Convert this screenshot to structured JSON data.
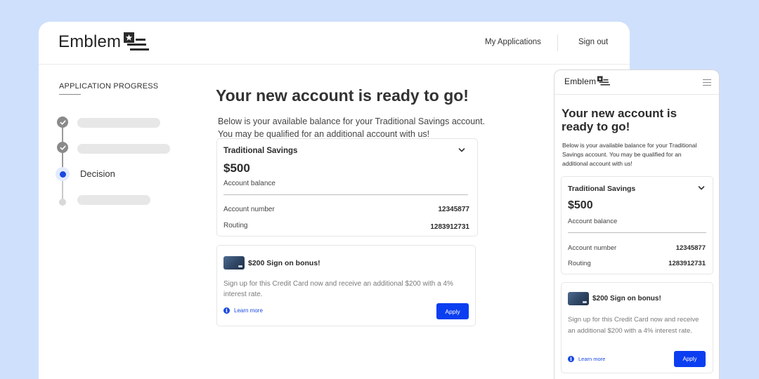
{
  "brand": {
    "name": "Emblem"
  },
  "nav": {
    "my_applications": "My Applications",
    "sign_out": "Sign out"
  },
  "progress": {
    "title": "APPLICATION PROGRESS",
    "steps": [
      {
        "status": "complete"
      },
      {
        "status": "complete"
      },
      {
        "status": "current",
        "label": "Decision"
      },
      {
        "status": "pending"
      }
    ]
  },
  "main": {
    "title": "Your new account is ready to go!",
    "desc_line1": "Below is your available balance for your Traditional Savings account.",
    "desc_line2": "You may be qualified for an additional account with us!",
    "description": "Below is your available balance for your Traditional Savings account. You may be qualified for an additional account with us!"
  },
  "account": {
    "name": "Traditional Savings",
    "balance": "$500",
    "balance_label": "Account balance",
    "account_number_label": "Account number",
    "account_number": "12345877",
    "routing_label": "Routing",
    "routing": "1283912731"
  },
  "bonus": {
    "title": "$200 Sign on bonus!",
    "description": "Sign up for this Credit Card now and receive an additional $200 with a 4% interest rate.",
    "learn_more": "Learn more",
    "apply": "Apply"
  },
  "icons": {
    "logo": "flag-icon",
    "chevron": "chevron-down-icon",
    "check": "check-icon",
    "info": "info-icon",
    "menu": "hamburger-menu-icon",
    "card": "credit-card-icon"
  },
  "colors": {
    "background": "#cfe0fc",
    "accent": "#0b3ef0",
    "link": "#1a49e0",
    "text": "#2b2b2b"
  }
}
